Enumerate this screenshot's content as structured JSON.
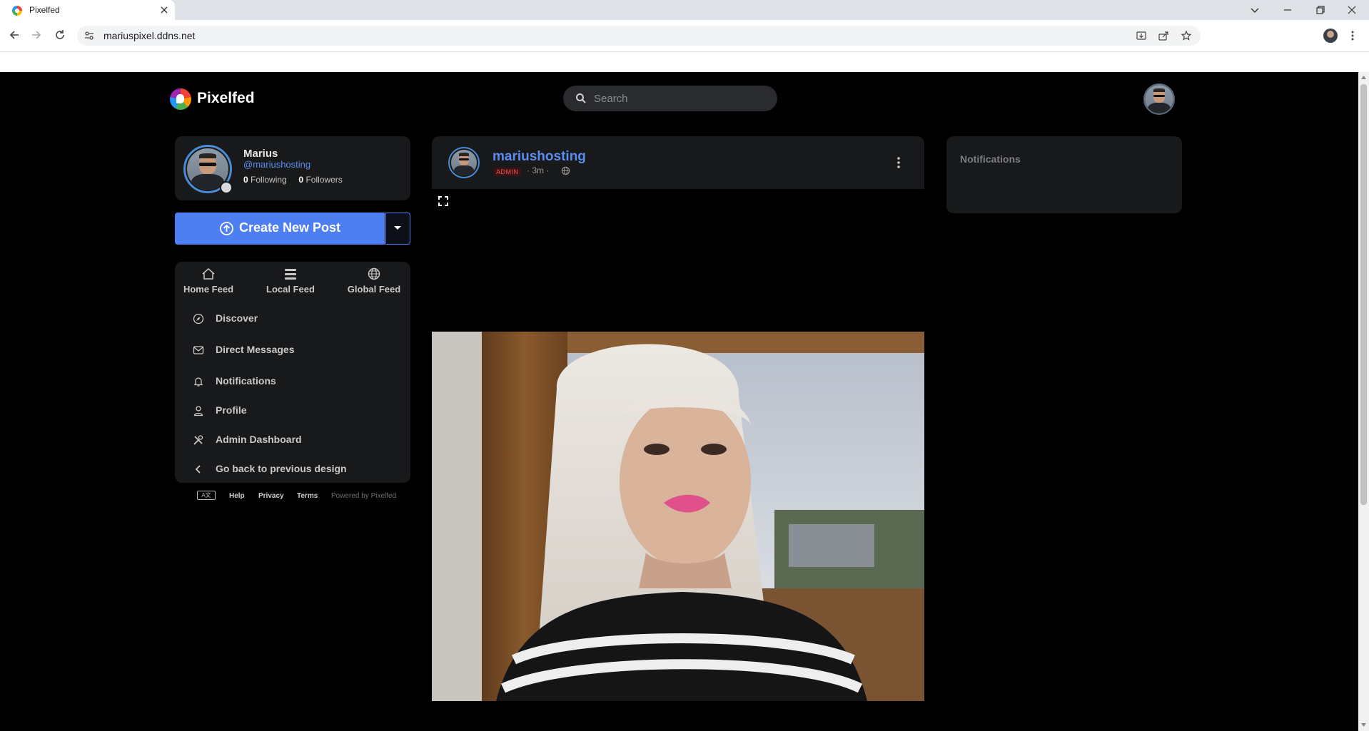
{
  "browser": {
    "tab_title": "Pixelfed",
    "url": "mariuspixel.ddns.net"
  },
  "header": {
    "brand": "Pixelfed",
    "search_placeholder": "Search"
  },
  "profile": {
    "name": "Marius",
    "handle": "@mariushosting",
    "following_count": "0",
    "following_label": "Following",
    "followers_count": "0",
    "followers_label": "Followers"
  },
  "create": {
    "label": "Create New Post"
  },
  "feeds": [
    {
      "label": "Home Feed",
      "icon": "home-icon"
    },
    {
      "label": "Local Feed",
      "icon": "stack-icon"
    },
    {
      "label": "Global Feed",
      "icon": "globe-icon"
    }
  ],
  "menu": [
    {
      "label": "Discover",
      "icon": "compass-icon"
    },
    {
      "label": "Direct Messages",
      "icon": "envelope-icon"
    },
    {
      "label": "Notifications",
      "icon": "bell-icon"
    },
    {
      "label": "Profile",
      "icon": "user-icon"
    },
    {
      "label": "Admin Dashboard",
      "icon": "tools-icon"
    },
    {
      "label": "Go back to previous design",
      "icon": "chevron-left-icon"
    }
  ],
  "footer": {
    "lang_badge": "A文",
    "help": "Help",
    "privacy": "Privacy",
    "terms": "Terms",
    "powered": "Powered by Pixelfed"
  },
  "post": {
    "username": "mariushosting",
    "badge": "ADMIN",
    "time": "· 3m ·"
  },
  "notifications": {
    "title": "Notifications"
  },
  "colors": {
    "accent": "#4d7ff2",
    "link": "#5b8def",
    "card_bg": "#18191b",
    "page_bg": "#000000",
    "admin_red": "#f25555"
  }
}
